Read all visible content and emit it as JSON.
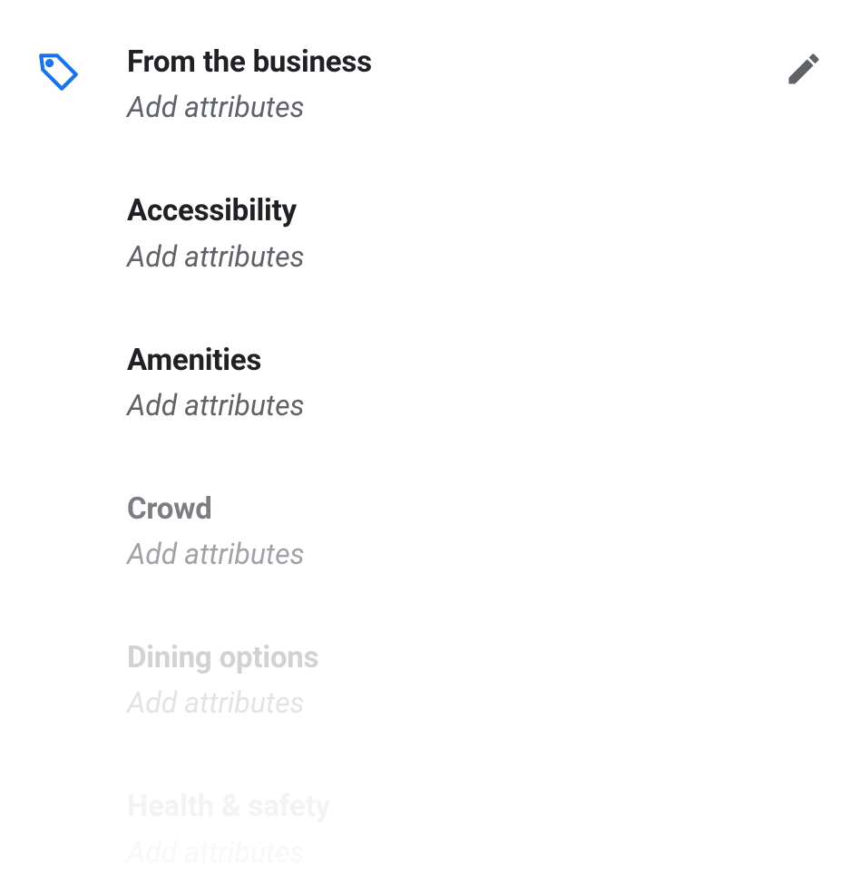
{
  "colors": {
    "accent": "#1a73e8",
    "iconGray": "#5f6368"
  },
  "attributes": {
    "items": [
      {
        "title": "From the business",
        "action": "Add attributes",
        "fade": ""
      },
      {
        "title": "Accessibility",
        "action": "Add attributes",
        "fade": ""
      },
      {
        "title": "Amenities",
        "action": "Add attributes",
        "fade": ""
      },
      {
        "title": "Crowd",
        "action": "Add attributes",
        "fade": "faded-1"
      },
      {
        "title": "Dining options",
        "action": "Add attributes",
        "fade": "faded-2"
      },
      {
        "title": "Health & safety",
        "action": "Add attributes",
        "fade": "faded-3"
      }
    ]
  }
}
